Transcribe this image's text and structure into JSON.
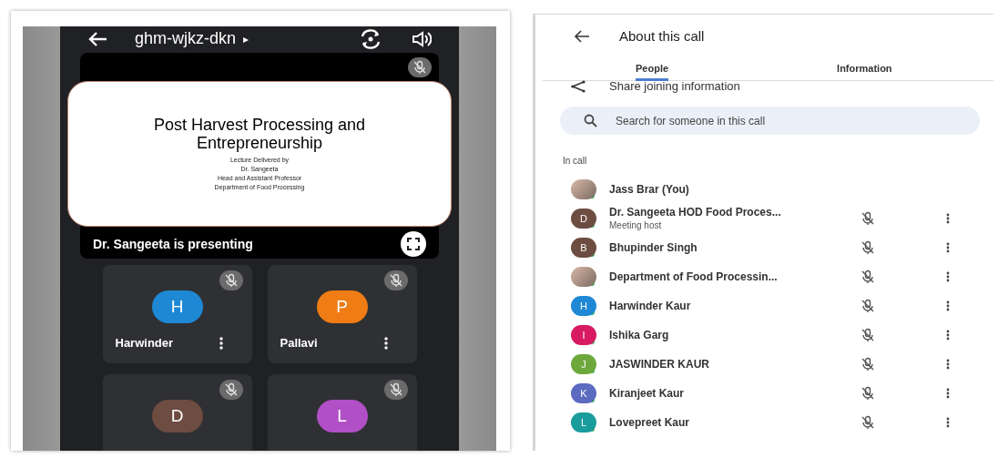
{
  "meeting": {
    "code": "ghm-wjkz-dkn",
    "caret": "▸",
    "presentation": {
      "slide": {
        "title": "Post Harvest Processing and Entrepreneurship",
        "lines": [
          "Lecture Delivered by",
          "Dr. Sangeeta",
          "Head and Assistant Professor",
          "Department of Food Processing"
        ]
      },
      "caption": "Dr. Sangeeta is presenting"
    },
    "tiles": [
      {
        "initial": "H",
        "color": "#1e88d4",
        "name": "Harwinder"
      },
      {
        "initial": "P",
        "color": "#ef7c14",
        "name": "Pallavi"
      },
      {
        "initial": "D",
        "color": "#6d4c41"
      },
      {
        "initial": "L",
        "color": "#b04fc6"
      }
    ]
  },
  "about": {
    "title": "About this call",
    "tabs": [
      {
        "label": "People",
        "selected": true
      },
      {
        "label": "Information",
        "selected": false
      }
    ],
    "share": "Share joining information",
    "search": {
      "placeholder": "Search for someone in this call"
    },
    "section": "In call",
    "people": [
      {
        "kind": "photo",
        "name": "Jass Brar (You)",
        "controls": false
      },
      {
        "kind": "initial",
        "initial": "D",
        "color": "#6d4c41",
        "name": "Dr. Sangeeta HOD Food Proces...",
        "subtitle": "Meeting host",
        "controls": true
      },
      {
        "kind": "initial",
        "initial": "B",
        "color": "#6d4c41",
        "name": "Bhupinder Singh",
        "controls": true
      },
      {
        "kind": "photo",
        "name": "Department of Food Processin...",
        "controls": true
      },
      {
        "kind": "initial",
        "initial": "H",
        "color": "#1e88d4",
        "name": "Harwinder Kaur",
        "controls": true
      },
      {
        "kind": "initial",
        "initial": "I",
        "color": "#d81b60",
        "name": "Ishika Garg",
        "controls": true
      },
      {
        "kind": "initial",
        "initial": "J",
        "color": "#6ea83c",
        "name": "JASWINDER KAUR",
        "controls": true
      },
      {
        "kind": "initial",
        "initial": "K",
        "color": "#5c6bc0",
        "name": "Kiranjeet Kaur",
        "controls": true
      },
      {
        "kind": "initial",
        "initial": "L",
        "color": "#1a9c9c",
        "name": "Lovepreet Kaur",
        "controls": true
      }
    ]
  }
}
